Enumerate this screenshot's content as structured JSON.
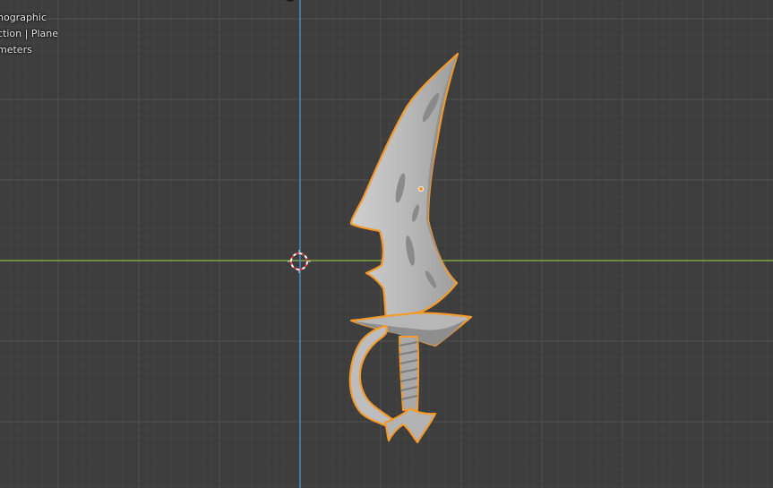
{
  "viewport": {
    "view_info": {
      "line1": "hographic",
      "line2": "ction | Plane",
      "line3": "meters"
    },
    "colors": {
      "background": "#3d3d3d",
      "grid_minor": "#444444",
      "grid_major": "#4e4e4e",
      "x_axis": "#7fa33f",
      "z_axis": "#4c8ad1",
      "selection_outline": "#f39a2d",
      "mesh": "#b9b9b9"
    },
    "icons": {
      "cursor": "3d-cursor-icon",
      "origin": "object-origin-icon"
    }
  }
}
